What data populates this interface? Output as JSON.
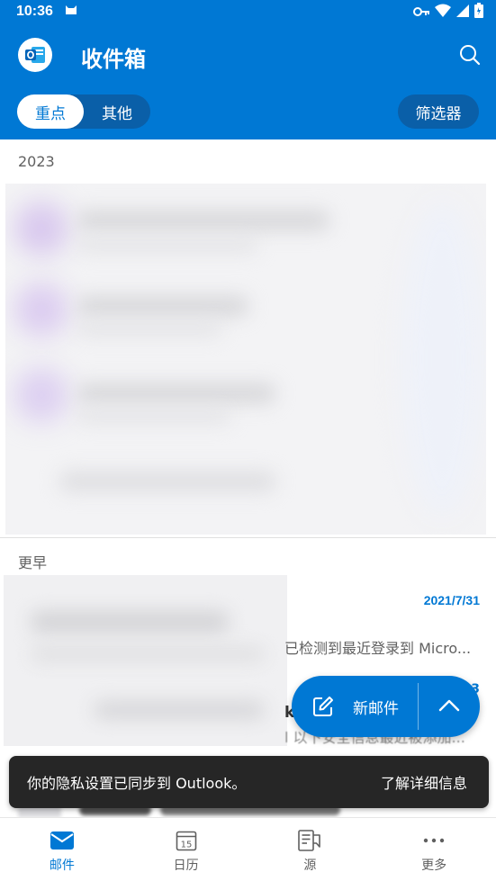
{
  "status_bar": {
    "time": "10:36"
  },
  "app_bar": {
    "title": "收件箱",
    "logo_icon": "outlook-logo-icon",
    "search_icon": "search-icon"
  },
  "tabs": {
    "focused_label": "重点",
    "other_label": "其他",
    "filter_label": "筛选器"
  },
  "sections": {
    "year_2023": "2023",
    "earlier": "更早"
  },
  "email_preview": {
    "date": "2021/7/31",
    "snippet": "已检测到最近登录到 Micro...",
    "peek_date_fragment": "3",
    "peek_title_fragment": "k",
    "peek_snippet_fragment": "l 以下安全信息最近被添加..."
  },
  "fab": {
    "compose_label": "新邮件",
    "compose_icon": "compose-icon",
    "expand_icon": "chevron-up-icon"
  },
  "snackbar": {
    "message": "你的隐私设置已同步到 Outlook。",
    "action": "了解详细信息"
  },
  "bottom_nav": {
    "items": [
      {
        "label": "邮件",
        "icon": "mail-icon",
        "active": true
      },
      {
        "label": "日历",
        "icon": "calendar-icon",
        "active": false,
        "icon_text": "15"
      },
      {
        "label": "源",
        "icon": "feed-icon",
        "active": false
      },
      {
        "label": "更多",
        "icon": "more-icon",
        "active": false
      }
    ]
  },
  "colors": {
    "brand": "#0078d4",
    "snackbar_bg": "#262626"
  }
}
